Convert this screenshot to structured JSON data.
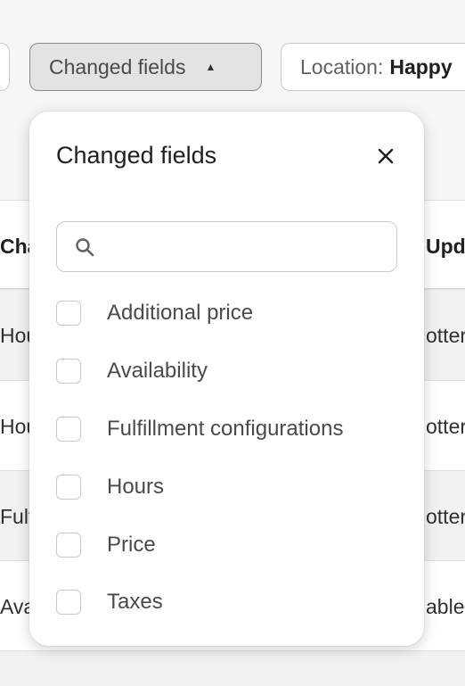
{
  "filters": {
    "changed_fields_label": "Changed fields",
    "location_label": "Location:",
    "location_value": "Happy"
  },
  "table": {
    "header": {
      "col1": "Cha",
      "col2": "Upda"
    },
    "rows": [
      {
        "col1": "Hou",
        "col2": "otter"
      },
      {
        "col1": "Hou",
        "col2": "otter"
      },
      {
        "col1": "Fulf",
        "col2": "otter"
      },
      {
        "col1": "Ava",
        "col2": "able"
      }
    ]
  },
  "popover": {
    "title": "Changed fields",
    "search": {
      "value": "",
      "placeholder": ""
    },
    "options": [
      {
        "label": "Additional price",
        "checked": false
      },
      {
        "label": "Availability",
        "checked": false
      },
      {
        "label": "Fulfillment configurations",
        "checked": false
      },
      {
        "label": "Hours",
        "checked": false
      },
      {
        "label": "Price",
        "checked": false
      },
      {
        "label": "Taxes",
        "checked": false
      }
    ]
  },
  "icons": {
    "caret": "caret-up-icon",
    "close": "close-icon",
    "search": "search-icon"
  }
}
